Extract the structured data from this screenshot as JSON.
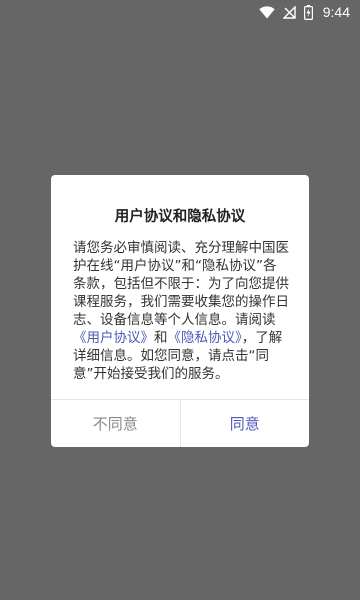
{
  "status_bar": {
    "time": "9:44",
    "battery_level": "9",
    "icons": [
      "wifi-icon",
      "signal-blocked-icon",
      "battery-charging-icon"
    ]
  },
  "dialog": {
    "title": "用户协议和隐私协议",
    "body": {
      "part1": "请您务必审慎阅读、充分理解中国医护在线“用户协议”和“隐私协议”各条款，包括但不限于：为了向您提供课程服务，我们需要收集您的操作日志、设备信息等个人信息。请阅读",
      "link_user_agreement": "《用户协议》",
      "and": "和",
      "link_privacy": "《隐私协议》",
      "part2": "，了解详细信息。如您同意，请点击“同意”开始接受我们的服务。"
    },
    "cancel_label": "不同意",
    "agree_label": "同意"
  },
  "colors": {
    "overlay": "#666666",
    "link": "#4f58b8",
    "cancel_text": "#8a8a8a"
  }
}
